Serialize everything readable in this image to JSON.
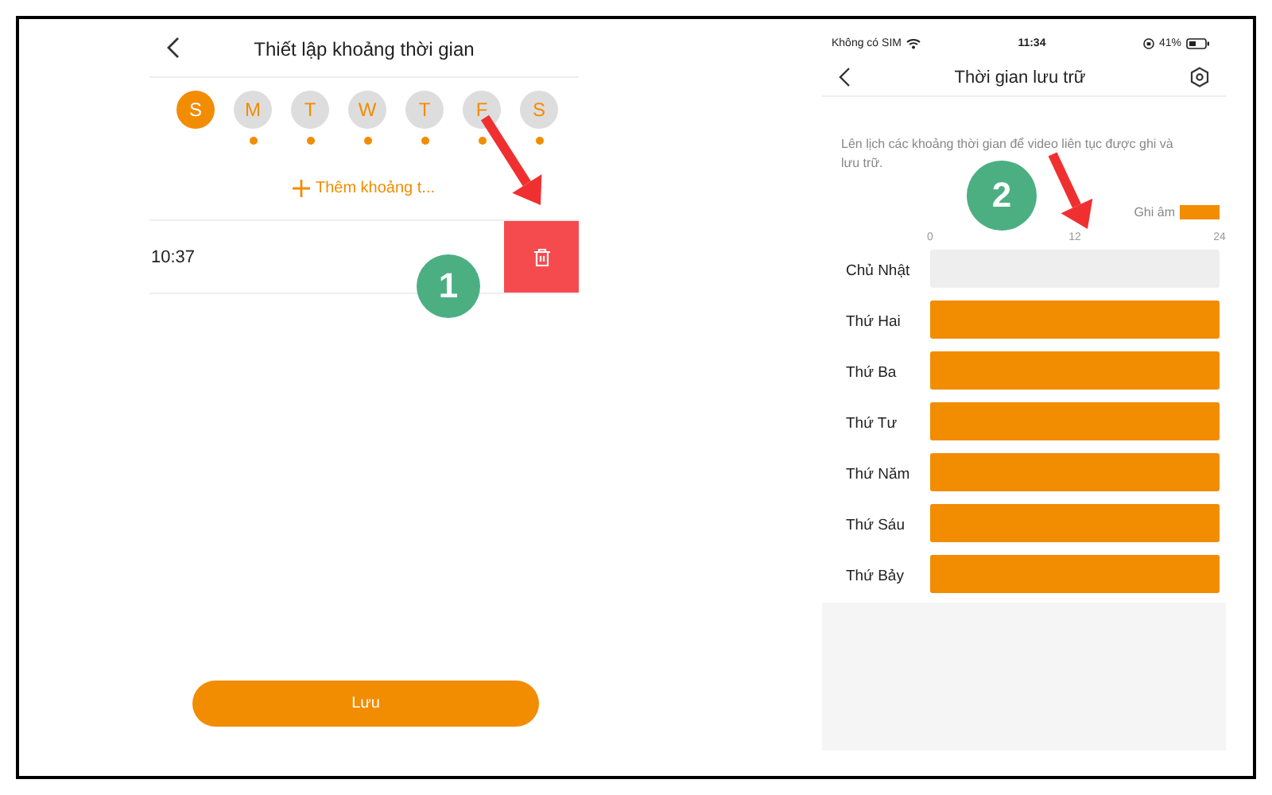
{
  "left_screen": {
    "title": "Thiết lập khoảng thời gian",
    "days": [
      {
        "label": "S",
        "selected": true,
        "scheduled": false
      },
      {
        "label": "M",
        "selected": false,
        "scheduled": true
      },
      {
        "label": "T",
        "selected": false,
        "scheduled": true
      },
      {
        "label": "W",
        "selected": false,
        "scheduled": true
      },
      {
        "label": "T",
        "selected": false,
        "scheduled": true
      },
      {
        "label": "F",
        "selected": false,
        "scheduled": true
      },
      {
        "label": "S",
        "selected": false,
        "scheduled": true
      }
    ],
    "add_button": "Thêm khoảng t...",
    "periods": [
      {
        "time": "10:37"
      }
    ],
    "save_button": "Lưu"
  },
  "right_screen": {
    "status_bar": {
      "carrier": "Không có SIM",
      "time": "11:34",
      "battery": "41%"
    },
    "title": "Thời gian lưu trữ",
    "description": "Lên lịch các khoảng thời gian để video liên tục được ghi và lưu trữ.",
    "schedule": {
      "chart_data": {
        "type": "bar",
        "orientation": "horizontal",
        "categories": [
          "Chủ Nhật",
          "Thứ Hai",
          "Thứ Ba",
          "Thứ Tư",
          "Thứ Năm",
          "Thứ Sáu",
          "Thứ Bảy"
        ],
        "series": [
          {
            "name": "Ghi âm",
            "color": "#f28c00",
            "values": [
              0,
              24,
              24,
              24,
              24,
              24,
              24
            ]
          },
          {
            "color": "#eeeeee",
            "values": [
              24,
              0,
              0,
              0,
              0,
              0,
              0
            ]
          }
        ],
        "stacked": true,
        "xlim": [
          0,
          24
        ],
        "xticks": [
          0,
          12,
          24
        ]
      }
    }
  },
  "callouts": [
    {
      "number": "1"
    },
    {
      "number": "2"
    }
  ]
}
